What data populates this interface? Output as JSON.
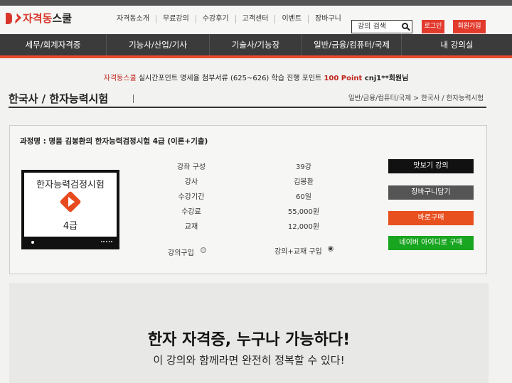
{
  "site": {
    "logo_brand": "자격동",
    "logo_suffix": "스쿨"
  },
  "top_nav": [
    "자격동소개",
    "무료강의",
    "수강후기",
    "고객센터",
    "이벤트",
    "장바구니"
  ],
  "search": {
    "placeholder": "강의 검색"
  },
  "auth": {
    "login": "로그인",
    "signup": "회원가입"
  },
  "main_nav": [
    "세무/회계자격증",
    "기능사/산업/기사",
    "기술사/기능장",
    "일반/금융/컴퓨터/국제",
    "내 강의실"
  ],
  "notice": {
    "brand": "자격동스쿨",
    "text": " 실시간포인트 명세율 첨부서류 (625~626) 학습 진행 포인트 ",
    "points": "100 Point",
    "user": " cnj1**회원님"
  },
  "page": {
    "title": "한국사 / 한자능력시험",
    "breadcrumb": "일반/금융/컴퓨터/국제 > 한국사 / 한자능력시험"
  },
  "course": {
    "name": "과정명 : 명품 김봉환의 한자능력검정시험 4급 (이론+기출)",
    "thumb_title": "한자능력검정시험",
    "thumb_grade": "4급",
    "info": [
      {
        "label": "강좌 구성",
        "value": "39강"
      },
      {
        "label": "강사",
        "value": "김봉환"
      },
      {
        "label": "수강기간",
        "value": "60일"
      },
      {
        "label": "수강료",
        "value": "55,000원"
      },
      {
        "label": "교재",
        "value": "12,000원"
      }
    ],
    "options": [
      {
        "label": "강의구입",
        "selected": false
      },
      {
        "label": "강의+교재 구입",
        "selected": true
      }
    ],
    "buttons": [
      {
        "label": "맛보기 강의",
        "color": "#111111"
      },
      {
        "label": "장바구니담기",
        "color": "#555555"
      },
      {
        "label": "바로구매",
        "color": "#e8501f"
      },
      {
        "label": "네이버 아이디로 구매",
        "color": "#18a51f"
      }
    ]
  },
  "promo": {
    "headline": "한자 자격증, 누구나 가능하다!",
    "sub": "이 강의와 함께라면 완전히 정복할 수 있다!"
  },
  "colors": {
    "accent": "#e23b2e",
    "nav_bg": "#3b3b3b",
    "nav_line": "#e74a2d"
  }
}
